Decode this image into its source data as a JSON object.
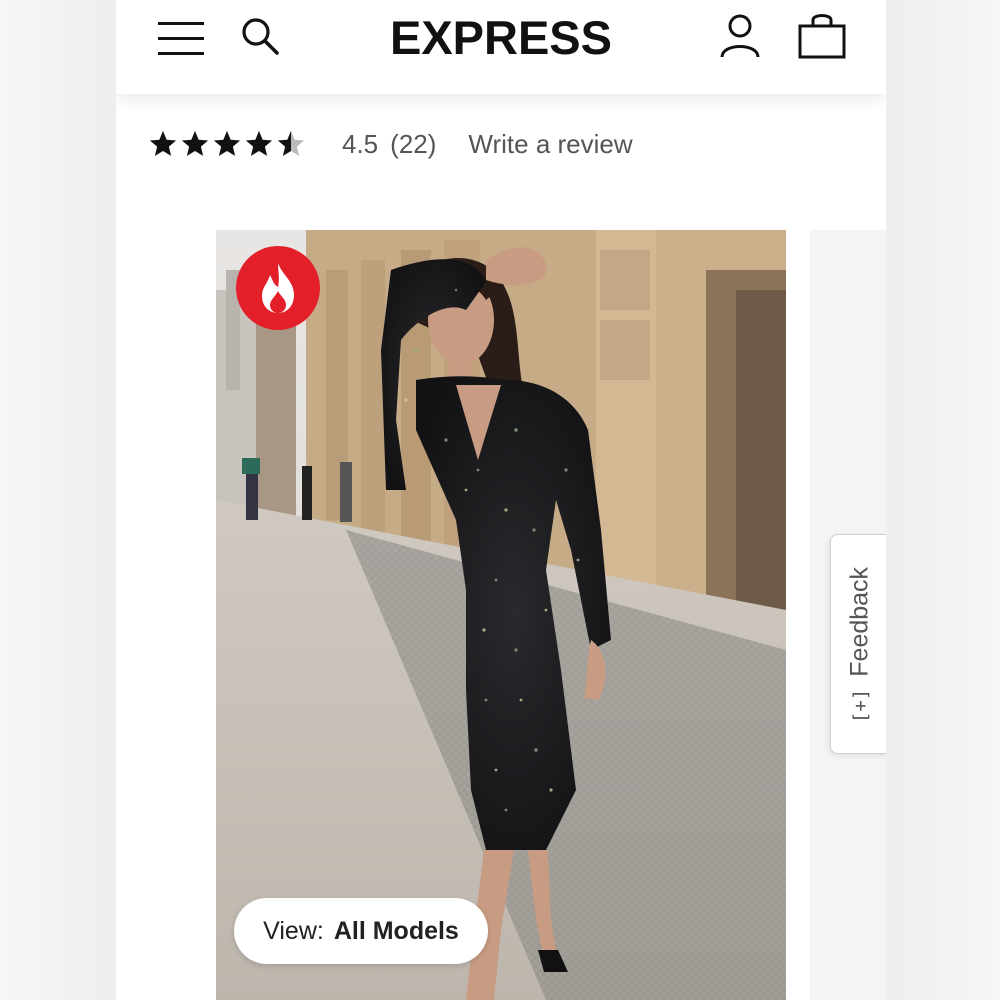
{
  "header": {
    "logo": "EXPRESS",
    "menu_icon": "hamburger-menu-icon",
    "search_icon": "search-icon",
    "account_icon": "account-icon",
    "bag_icon": "shopping-bag-icon"
  },
  "rating": {
    "stars": 4.5,
    "value": "4.5",
    "count": "(22)",
    "write_review": "Write a review"
  },
  "product": {
    "badge_icon": "flame-icon",
    "badge_color": "#e3202a",
    "view_label": "View:",
    "view_value": "All Models"
  },
  "feedback": {
    "icon": "[+]",
    "label": "Feedback"
  }
}
